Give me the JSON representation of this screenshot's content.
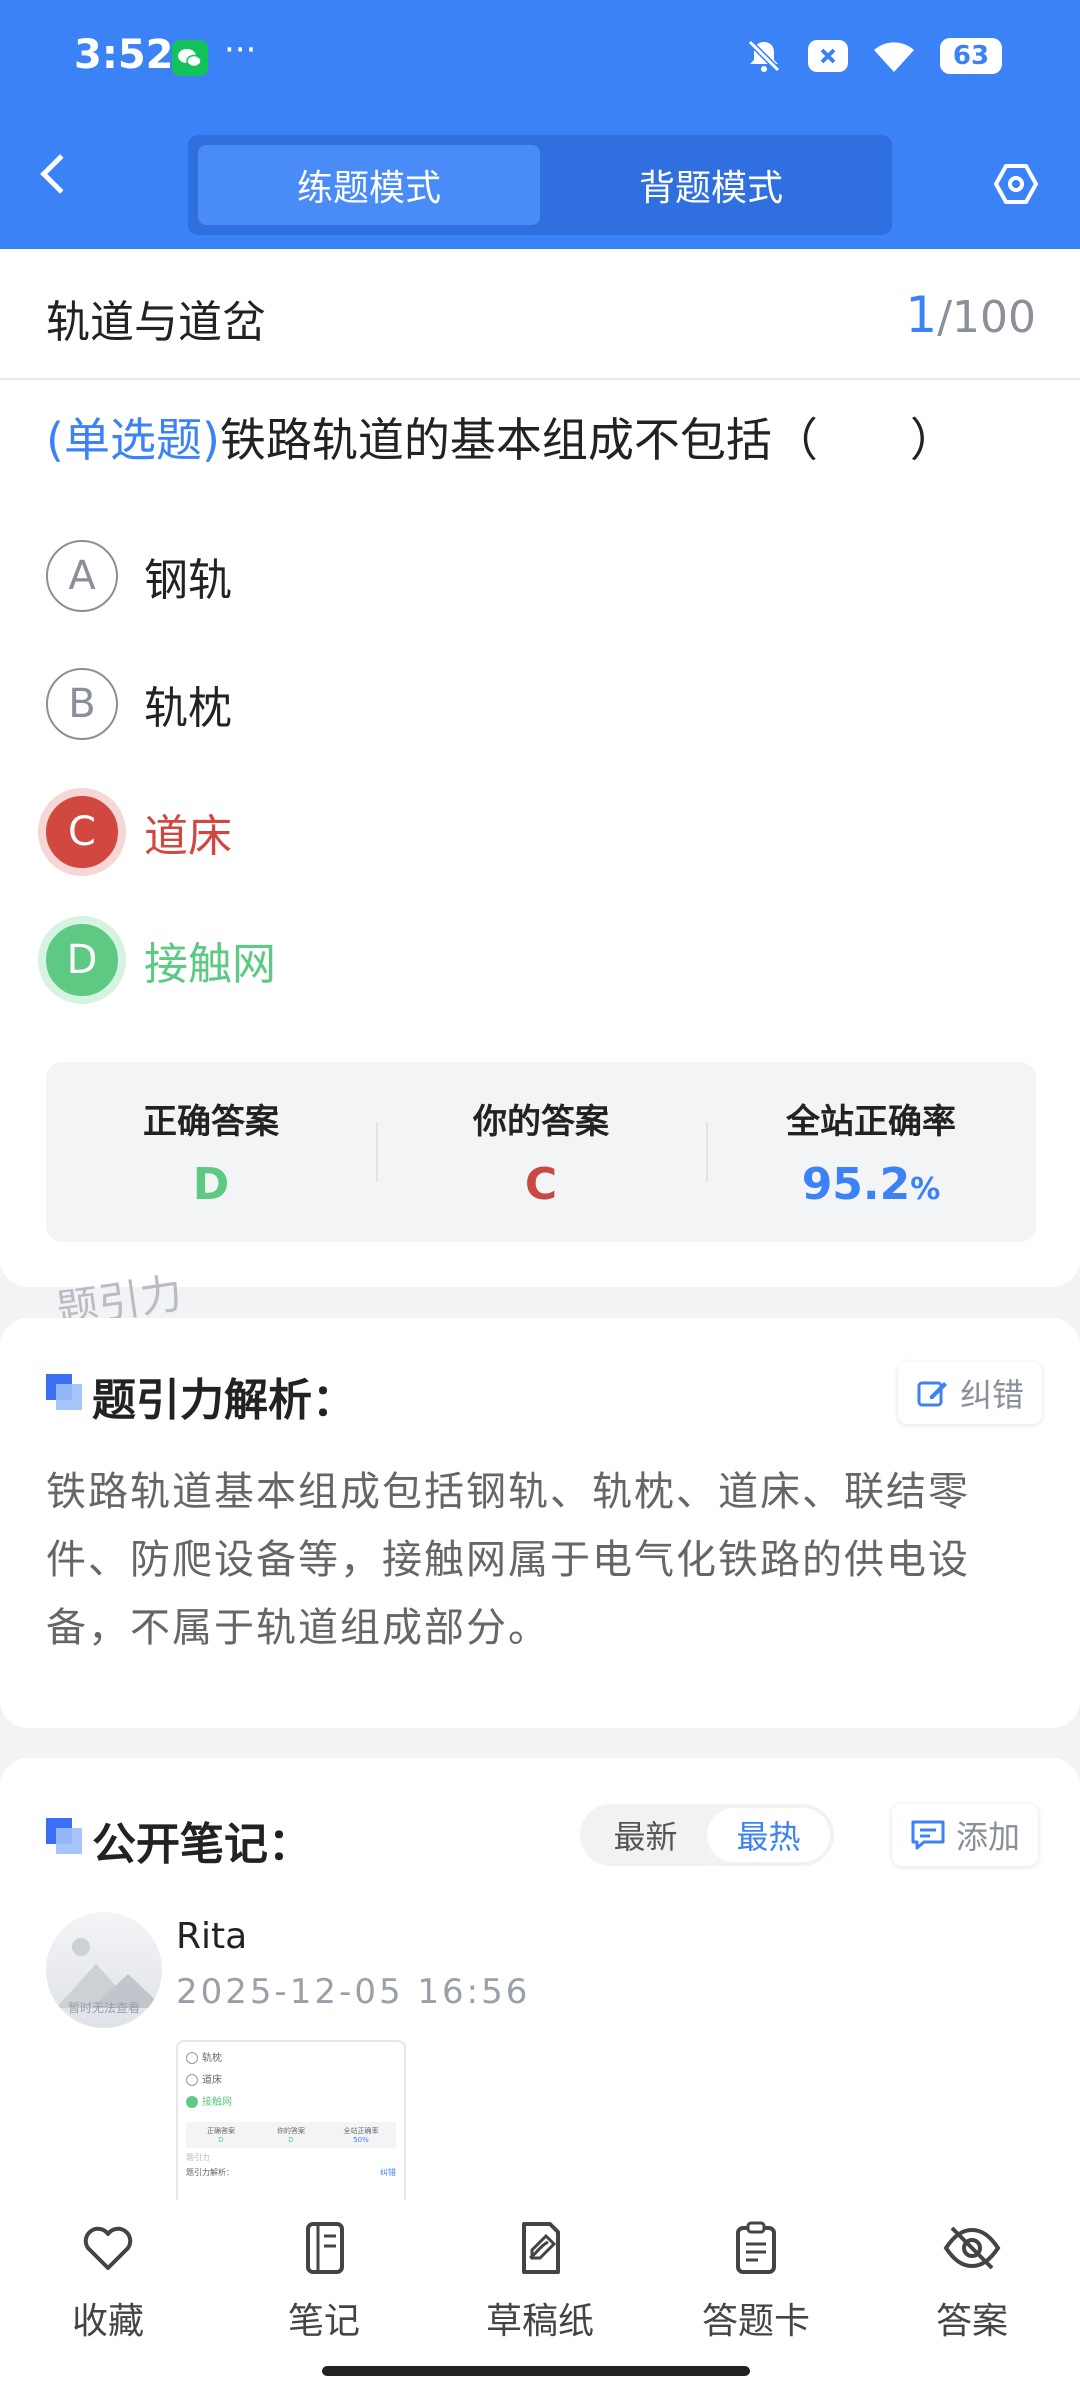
{
  "status_bar": {
    "time": "3:52",
    "dots": "···",
    "battery": "63"
  },
  "header": {
    "tabs": [
      {
        "label": "练题模式"
      },
      {
        "label": "背题模式"
      }
    ],
    "active_tab": 0
  },
  "question": {
    "subject": "轨道与道岔",
    "current": "1",
    "total": "/100",
    "type": "(单选题)",
    "text": "铁路轨道的基本组成不包括（　　）",
    "options": [
      {
        "letter": "A",
        "text": "钢轨",
        "state": "normal"
      },
      {
        "letter": "B",
        "text": "轨枕",
        "state": "normal"
      },
      {
        "letter": "C",
        "text": "道床",
        "state": "wrong"
      },
      {
        "letter": "D",
        "text": "接触网",
        "state": "correct"
      }
    ]
  },
  "stats": {
    "correct_label": "正确答案",
    "correct_value": "D",
    "yours_label": "你的答案",
    "yours_value": "C",
    "rate_label": "全站正确率",
    "rate_value": "95.2",
    "rate_unit": "%"
  },
  "watermark": "题引力",
  "analysis": {
    "title": "题引力解析：",
    "report_label": "纠错",
    "text": "铁路轨道基本组成包括钢轨、轨枕、道床、联结零件、防爬设备等，接触网属于电气化铁路的供电设备，不属于轨道组成部分。"
  },
  "notes": {
    "title": "公开笔记：",
    "sort_tabs": [
      {
        "label": "最新"
      },
      {
        "label": "最热"
      }
    ],
    "active_sort": 1,
    "add_label": "添加",
    "items": [
      {
        "avatar_caption": "暂时无法查看",
        "user": "Rita",
        "time": "2025-12-05 16:56",
        "thumb": {
          "opt_b": "轨枕",
          "opt_c": "道床",
          "opt_d": "接触网",
          "c1": "正确答案",
          "c2": "你的答案",
          "c3": "全站正确率",
          "v1": "D",
          "v2": "D",
          "v3": "50%",
          "wm": "题引力",
          "title": "题引力解析：",
          "report": "纠错"
        }
      }
    ]
  },
  "bottom_nav": [
    {
      "label": "收藏",
      "icon": "heart-icon"
    },
    {
      "label": "笔记",
      "icon": "notebook-icon"
    },
    {
      "label": "草稿纸",
      "icon": "draft-paper-icon"
    },
    {
      "label": "答题卡",
      "icon": "answer-sheet-icon"
    },
    {
      "label": "答案",
      "icon": "eye-off-icon"
    }
  ],
  "colors": {
    "primary": "#3b82f6",
    "correct": "#5ec983",
    "wrong": "#d0483f"
  }
}
